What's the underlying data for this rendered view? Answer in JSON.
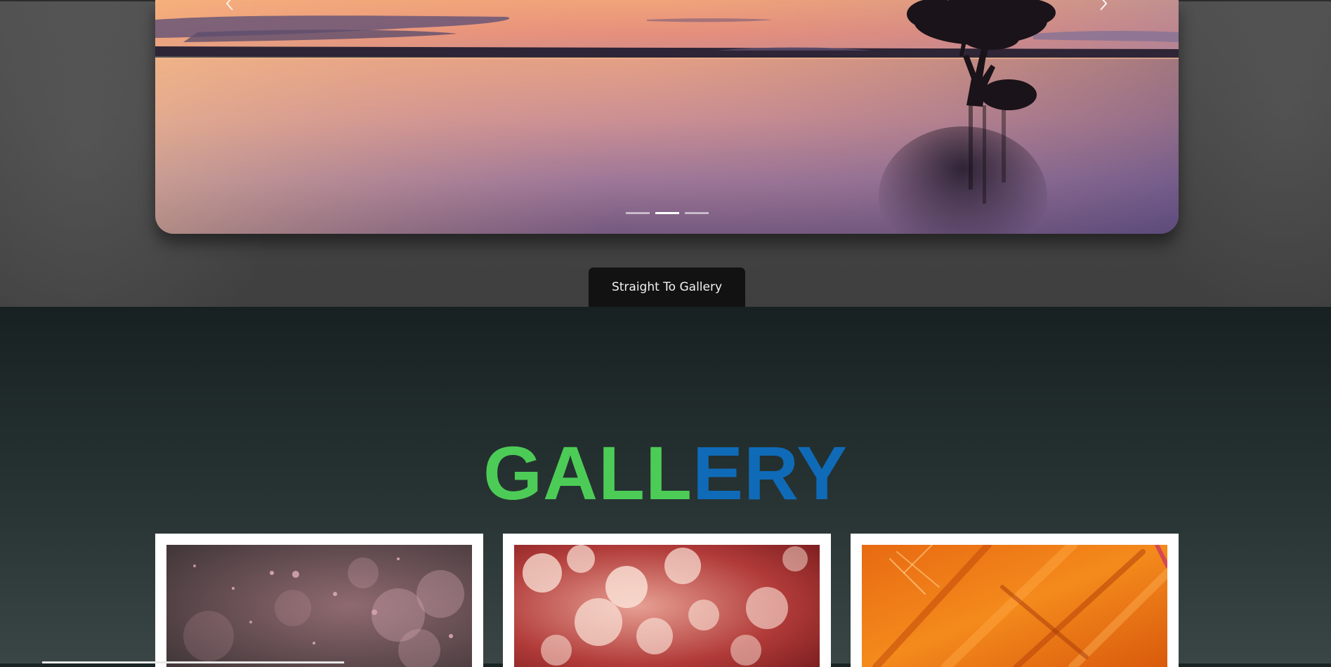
{
  "carousel": {
    "slides_total": 3,
    "active_slide": 2,
    "prev_icon": "chevron-left-icon",
    "next_icon": "chevron-right-icon"
  },
  "hero": {
    "gallery_button_label": "Straight To Gallery"
  },
  "gallery": {
    "title_part1": "GALL",
    "title_part2": "ERY",
    "title_color1": "#4ccc57",
    "title_color2": "#0f6bb8",
    "cards": [
      {
        "description": "pink-bokeh-dust"
      },
      {
        "description": "red-white-bokeh"
      },
      {
        "description": "orange-paint-texture"
      }
    ]
  }
}
